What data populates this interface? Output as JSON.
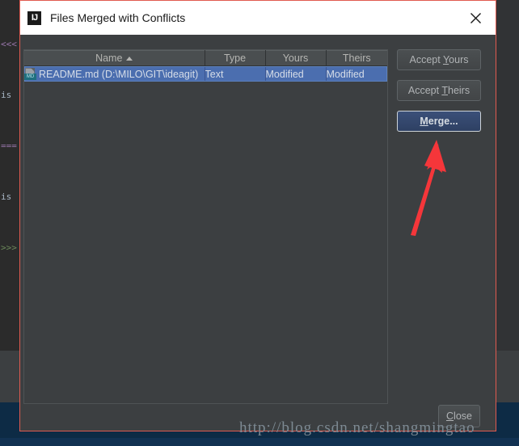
{
  "window": {
    "title": "Files Merged with Conflicts",
    "app_icon_label": "IJ",
    "close_icon_name": "close-icon"
  },
  "background": {
    "code_lines": [
      "<<<",
      "is",
      "===",
      "is",
      ">>>"
    ]
  },
  "table": {
    "columns": [
      {
        "label": "Name",
        "sorted": "asc"
      },
      {
        "label": "Type",
        "sorted": ""
      },
      {
        "label": "Yours",
        "sorted": ""
      },
      {
        "label": "Theirs",
        "sorted": ""
      }
    ],
    "rows": [
      {
        "icon": "markdown-file-icon",
        "icon_label": "MD",
        "name": "README.md (D:\\MILO\\GIT\\ideagit)",
        "type": "Text",
        "yours": "Modified",
        "theirs": "Modified",
        "selected": true
      }
    ]
  },
  "actions": {
    "accept_yours": {
      "prefix": "Accept ",
      "mnemonic": "Y",
      "suffix": "ours"
    },
    "accept_theirs": {
      "prefix": "Accept ",
      "mnemonic": "T",
      "suffix": "heirs"
    },
    "merge": {
      "prefix": "",
      "mnemonic": "M",
      "suffix": "erge..."
    },
    "close": {
      "prefix": "",
      "mnemonic": "C",
      "suffix": "lose"
    }
  },
  "annotation": {
    "arrow_color": "#f5363a",
    "points_to": "merge-button"
  },
  "watermark": {
    "text": "http://blog.csdn.net/shangmingtao"
  },
  "colors": {
    "dialog_background": "#3c3f41",
    "selection_blue": "#4b6eaf",
    "focus_button_blue": "#3b5079",
    "annotation_red": "#f5363a",
    "dialog_border_red": "#e05a50"
  }
}
